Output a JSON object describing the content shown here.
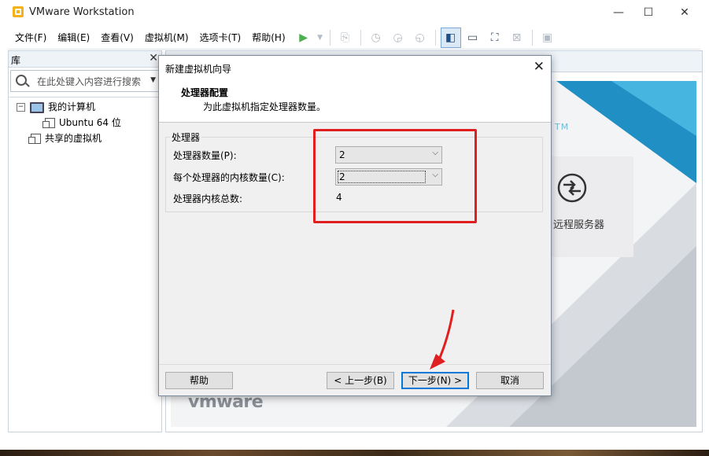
{
  "window": {
    "title": "VMware Workstation"
  },
  "menu": [
    "文件(F)",
    "编辑(E)",
    "查看(V)",
    "虚拟机(M)",
    "选项卡(T)",
    "帮助(H)"
  ],
  "library": {
    "title": "库",
    "search_placeholder": "在此处键入内容进行搜索",
    "tree": {
      "my_computer": "我的计算机",
      "vm": "Ubuntu 64 位",
      "shared": "共享的虚拟机"
    }
  },
  "home": {
    "tile_label": "远程服务器",
    "tm": "TM",
    "logo": "vmware"
  },
  "dialog": {
    "title": "新建虚拟机向导",
    "heading": "处理器配置",
    "subheading": "为此虚拟机指定处理器数量。",
    "group_title": "处理器",
    "fields": [
      {
        "label": "处理器数量(P):",
        "value": "2"
      },
      {
        "label": "每个处理器的内核数量(C):",
        "value": "2"
      }
    ],
    "total_label": "处理器内核总数:",
    "total_value": "4",
    "buttons": {
      "help": "帮助",
      "back": "< 上一步(B)",
      "next": "下一步(N) >",
      "cancel": "取消"
    }
  },
  "colors": {
    "highlight_box": "#e02020",
    "default_button": "#0078d7",
    "play": "#4caf50"
  }
}
